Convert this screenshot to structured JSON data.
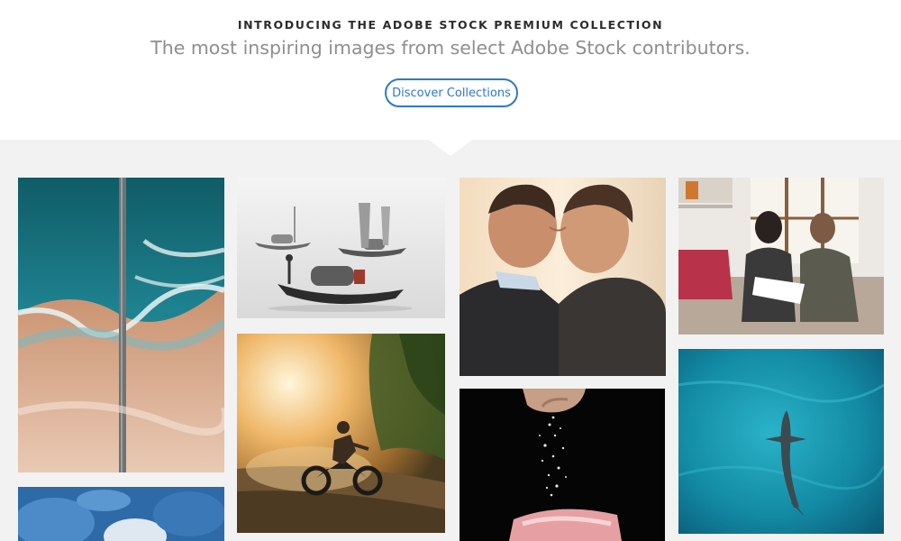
{
  "hero": {
    "eyebrow": "INTRODUCING THE ADOBE STOCK PREMIUM COLLECTION",
    "headline": "The most inspiring images from select Adobe Stock contributors.",
    "cta_label": "Discover Collections"
  },
  "colors": {
    "accent": "#2d79c7",
    "gallery_background": "#f2f2f2"
  }
}
